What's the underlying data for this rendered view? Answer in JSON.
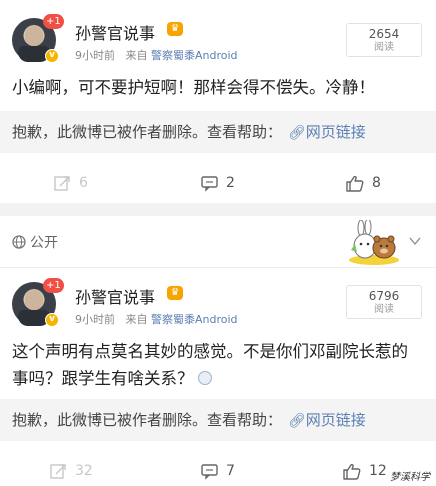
{
  "posts": [
    {
      "author": "孙警官说事",
      "badge_count": "+1",
      "time": "9小时前",
      "source_prefix": "来自",
      "source": "警察蜀黍Android",
      "reads_count": "2654",
      "reads_label": "阅读",
      "content": "小编啊，可不要护短啊！那样会得不偿失。冷静！",
      "deleted_notice": "抱歉，此微博已被作者删除。查看帮助：",
      "help_link": "网页链接",
      "reposts": "6",
      "comments": "2",
      "likes": "8"
    },
    {
      "author": "孙警官说事",
      "badge_count": "+1",
      "time": "9小时前",
      "source_prefix": "来自",
      "source": "警察蜀黍Android",
      "reads_count": "6796",
      "reads_label": "阅读",
      "content": "这个声明有点莫名其妙的感觉。不是你们邓副院长惹的事吗？跟学生有啥关系？",
      "deleted_notice": "抱歉，此微博已被作者删除。查看帮助：",
      "help_link": "网页链接",
      "reposts": "32",
      "comments": "7",
      "likes": "12"
    }
  ],
  "visibility": "公开",
  "watermark": "梦溪科学",
  "icons": [
    "repost-icon",
    "comment-icon",
    "like-icon",
    "globe-icon",
    "link-icon",
    "chevron-down-icon",
    "sticker-rabbit-bear"
  ],
  "colors": {
    "link": "#5b7fb3",
    "badge": "#f04f43",
    "crown": "#f7a400"
  }
}
